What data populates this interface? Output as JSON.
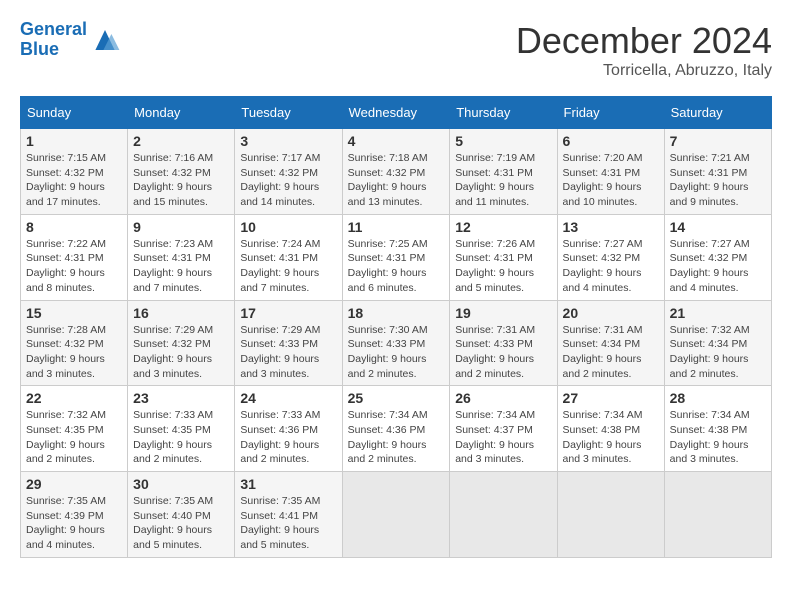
{
  "header": {
    "logo_line1": "General",
    "logo_line2": "Blue",
    "month": "December 2024",
    "location": "Torricella, Abruzzo, Italy"
  },
  "weekdays": [
    "Sunday",
    "Monday",
    "Tuesday",
    "Wednesday",
    "Thursday",
    "Friday",
    "Saturday"
  ],
  "weeks": [
    [
      {
        "day": "1",
        "sunrise": "7:15 AM",
        "sunset": "4:32 PM",
        "daylight": "9 hours and 17 minutes."
      },
      {
        "day": "2",
        "sunrise": "7:16 AM",
        "sunset": "4:32 PM",
        "daylight": "9 hours and 15 minutes."
      },
      {
        "day": "3",
        "sunrise": "7:17 AM",
        "sunset": "4:32 PM",
        "daylight": "9 hours and 14 minutes."
      },
      {
        "day": "4",
        "sunrise": "7:18 AM",
        "sunset": "4:32 PM",
        "daylight": "9 hours and 13 minutes."
      },
      {
        "day": "5",
        "sunrise": "7:19 AM",
        "sunset": "4:31 PM",
        "daylight": "9 hours and 11 minutes."
      },
      {
        "day": "6",
        "sunrise": "7:20 AM",
        "sunset": "4:31 PM",
        "daylight": "9 hours and 10 minutes."
      },
      {
        "day": "7",
        "sunrise": "7:21 AM",
        "sunset": "4:31 PM",
        "daylight": "9 hours and 9 minutes."
      }
    ],
    [
      {
        "day": "8",
        "sunrise": "7:22 AM",
        "sunset": "4:31 PM",
        "daylight": "9 hours and 8 minutes."
      },
      {
        "day": "9",
        "sunrise": "7:23 AM",
        "sunset": "4:31 PM",
        "daylight": "9 hours and 7 minutes."
      },
      {
        "day": "10",
        "sunrise": "7:24 AM",
        "sunset": "4:31 PM",
        "daylight": "9 hours and 7 minutes."
      },
      {
        "day": "11",
        "sunrise": "7:25 AM",
        "sunset": "4:31 PM",
        "daylight": "9 hours and 6 minutes."
      },
      {
        "day": "12",
        "sunrise": "7:26 AM",
        "sunset": "4:31 PM",
        "daylight": "9 hours and 5 minutes."
      },
      {
        "day": "13",
        "sunrise": "7:27 AM",
        "sunset": "4:32 PM",
        "daylight": "9 hours and 4 minutes."
      },
      {
        "day": "14",
        "sunrise": "7:27 AM",
        "sunset": "4:32 PM",
        "daylight": "9 hours and 4 minutes."
      }
    ],
    [
      {
        "day": "15",
        "sunrise": "7:28 AM",
        "sunset": "4:32 PM",
        "daylight": "9 hours and 3 minutes."
      },
      {
        "day": "16",
        "sunrise": "7:29 AM",
        "sunset": "4:32 PM",
        "daylight": "9 hours and 3 minutes."
      },
      {
        "day": "17",
        "sunrise": "7:29 AM",
        "sunset": "4:33 PM",
        "daylight": "9 hours and 3 minutes."
      },
      {
        "day": "18",
        "sunrise": "7:30 AM",
        "sunset": "4:33 PM",
        "daylight": "9 hours and 2 minutes."
      },
      {
        "day": "19",
        "sunrise": "7:31 AM",
        "sunset": "4:33 PM",
        "daylight": "9 hours and 2 minutes."
      },
      {
        "day": "20",
        "sunrise": "7:31 AM",
        "sunset": "4:34 PM",
        "daylight": "9 hours and 2 minutes."
      },
      {
        "day": "21",
        "sunrise": "7:32 AM",
        "sunset": "4:34 PM",
        "daylight": "9 hours and 2 minutes."
      }
    ],
    [
      {
        "day": "22",
        "sunrise": "7:32 AM",
        "sunset": "4:35 PM",
        "daylight": "9 hours and 2 minutes."
      },
      {
        "day": "23",
        "sunrise": "7:33 AM",
        "sunset": "4:35 PM",
        "daylight": "9 hours and 2 minutes."
      },
      {
        "day": "24",
        "sunrise": "7:33 AM",
        "sunset": "4:36 PM",
        "daylight": "9 hours and 2 minutes."
      },
      {
        "day": "25",
        "sunrise": "7:34 AM",
        "sunset": "4:36 PM",
        "daylight": "9 hours and 2 minutes."
      },
      {
        "day": "26",
        "sunrise": "7:34 AM",
        "sunset": "4:37 PM",
        "daylight": "9 hours and 3 minutes."
      },
      {
        "day": "27",
        "sunrise": "7:34 AM",
        "sunset": "4:38 PM",
        "daylight": "9 hours and 3 minutes."
      },
      {
        "day": "28",
        "sunrise": "7:34 AM",
        "sunset": "4:38 PM",
        "daylight": "9 hours and 3 minutes."
      }
    ],
    [
      {
        "day": "29",
        "sunrise": "7:35 AM",
        "sunset": "4:39 PM",
        "daylight": "9 hours and 4 minutes."
      },
      {
        "day": "30",
        "sunrise": "7:35 AM",
        "sunset": "4:40 PM",
        "daylight": "9 hours and 5 minutes."
      },
      {
        "day": "31",
        "sunrise": "7:35 AM",
        "sunset": "4:41 PM",
        "daylight": "9 hours and 5 minutes."
      },
      null,
      null,
      null,
      null
    ]
  ]
}
